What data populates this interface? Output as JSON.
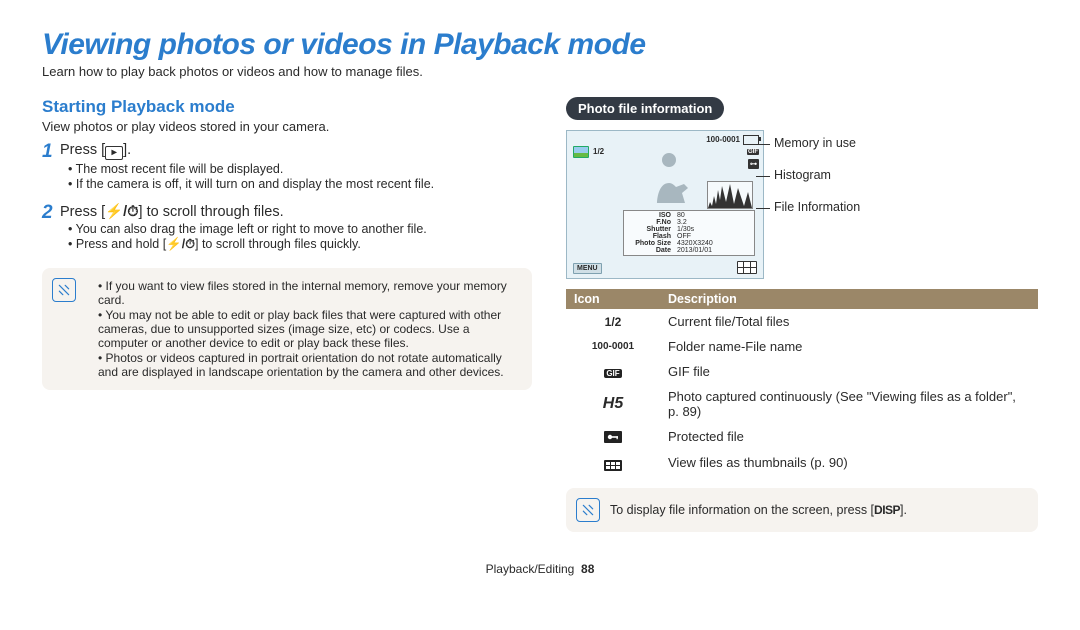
{
  "title": "Viewing photos or videos in Playback mode",
  "lead": "Learn how to play back photos or videos and how to manage files.",
  "left": {
    "heading": "Starting Playback mode",
    "sub": "View photos or play videos stored in your camera.",
    "step1": {
      "text_a": "Press [",
      "text_b": "].",
      "bul1": "The most recent file will be displayed.",
      "bul2": "If the camera is off, it will turn on and display the most recent file."
    },
    "step2": {
      "text_a": "Press [",
      "text_b": "] to scroll through files.",
      "bul1": "You can also drag the image left or right to move to another file.",
      "bul2_a": "Press and hold [",
      "bul2_b": "] to scroll through files quickly."
    },
    "notes": {
      "n1": "If you want to view files stored in the internal memory, remove your memory card.",
      "n2": "You may not be able to edit or play back files that were captured with other cameras, due to unsupported sizes (image size, etc) or codecs. Use a computer or another device to edit or play back these files.",
      "n3": "Photos or videos captured in portrait orientation do not rotate automatically and are displayed in landscape orientation by the camera and other devices."
    }
  },
  "right": {
    "pill": "Photo file information",
    "screen": {
      "counter": "1/2",
      "file_no": "100-0001",
      "menu": "MENU",
      "info": {
        "iso_k": "ISO",
        "iso_v": "80",
        "fno_k": "F.No",
        "fno_v": "3.2",
        "sh_k": "Shutter",
        "sh_v": "1/30s",
        "fl_k": "Flash",
        "fl_v": "OFF",
        "ps_k": "Photo Size",
        "ps_v": "4320X3240",
        "dt_k": "Date",
        "dt_v": "2013/01/01"
      }
    },
    "callouts": {
      "c1": "Memory in use",
      "c2": "Histogram",
      "c3": "File Information"
    },
    "table": {
      "h_icon": "Icon",
      "h_desc": "Description",
      "r1_i": "1/2",
      "r1_d": "Current file/Total files",
      "r2_i": "100-0001",
      "r2_d": "Folder name-File name",
      "r3_d": "GIF file",
      "r4_i": "H5",
      "r4_d": "Photo captured continuously (See \"Viewing files as a folder\", p. 89)",
      "r5_d": "Protected file",
      "r6_d": "View files as thumbnails (p. 90)"
    },
    "tip_a": "To display file information on the screen, press [",
    "tip_b": "].",
    "disp": "DISP"
  },
  "footer": {
    "section": "Playback/Editing",
    "page": "88"
  }
}
